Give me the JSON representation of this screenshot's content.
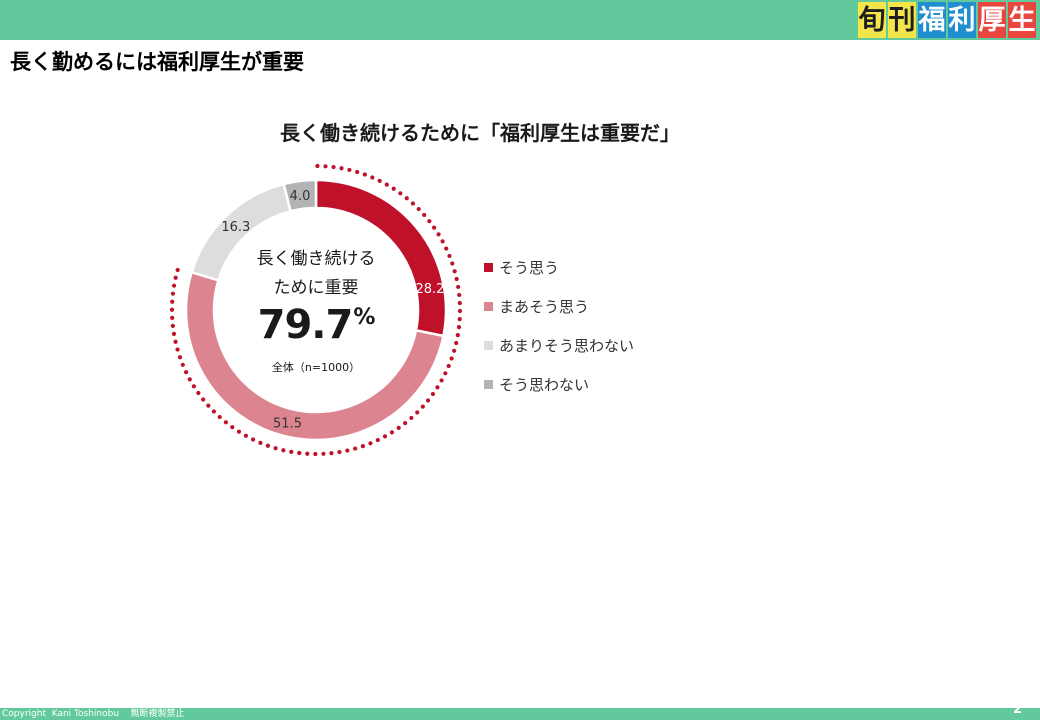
{
  "header": {
    "logo_chars": [
      "旬",
      "刊",
      "福",
      "利",
      "厚",
      "生"
    ]
  },
  "page_title": "長く勤めるには福利厚生が重要",
  "chart_data": {
    "type": "pie",
    "title": "長く働き続けるために「福利厚生は重要だ」",
    "categories": [
      "そう思う",
      "まあそう思う",
      "あまりそう思わない",
      "そう思わない"
    ],
    "values": [
      28.2,
      51.5,
      16.3,
      4.0
    ],
    "value_labels": [
      "28.2",
      "51.5",
      "16.3",
      "4.0"
    ],
    "colors": [
      "#c0112b",
      "#dc8590",
      "#dddddd",
      "#b3b3b3"
    ],
    "label_colors": [
      "#ffffff",
      "#333333",
      "#333333",
      "#333333"
    ],
    "highlight_color": "#c0112b",
    "center": {
      "line1": "長く働き続ける",
      "line2": "ために重要",
      "value": "79.7",
      "unit": "%",
      "note": "全体（n=1000）"
    },
    "legend_position": "right"
  },
  "footer": {
    "copyright": "Copyright  Kani Toshinobu    無断複製禁止",
    "page_number": "2"
  }
}
